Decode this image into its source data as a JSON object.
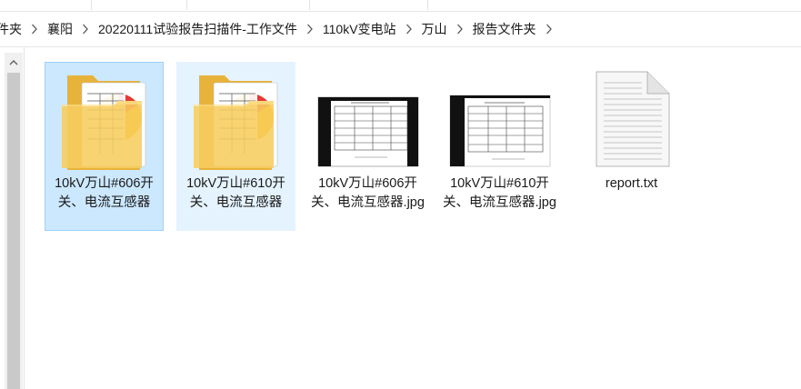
{
  "breadcrumb": {
    "items": [
      "件夹",
      "襄阳",
      "20220111试验报告扫描件-工作文件",
      "110kV变电站",
      "万山",
      "报告文件夹"
    ]
  },
  "files": [
    {
      "name": "10kV万山#606开关、电流互感器",
      "type": "folder",
      "state": "selected"
    },
    {
      "name": "10kV万山#610开关、电流互感器",
      "type": "folder",
      "state": "hover"
    },
    {
      "name": "10kV万山#606开关、电流互感器.jpg",
      "type": "image",
      "state": "normal"
    },
    {
      "name": "10kV万山#610开关、电流互感器.jpg",
      "type": "image",
      "state": "normal"
    },
    {
      "name": "report.txt",
      "type": "text",
      "state": "normal"
    }
  ],
  "colors": {
    "selected_bg": "#cce8ff",
    "selected_border": "#99d1ff",
    "hover_bg": "#e5f3ff",
    "folder": "#f5c85a"
  }
}
